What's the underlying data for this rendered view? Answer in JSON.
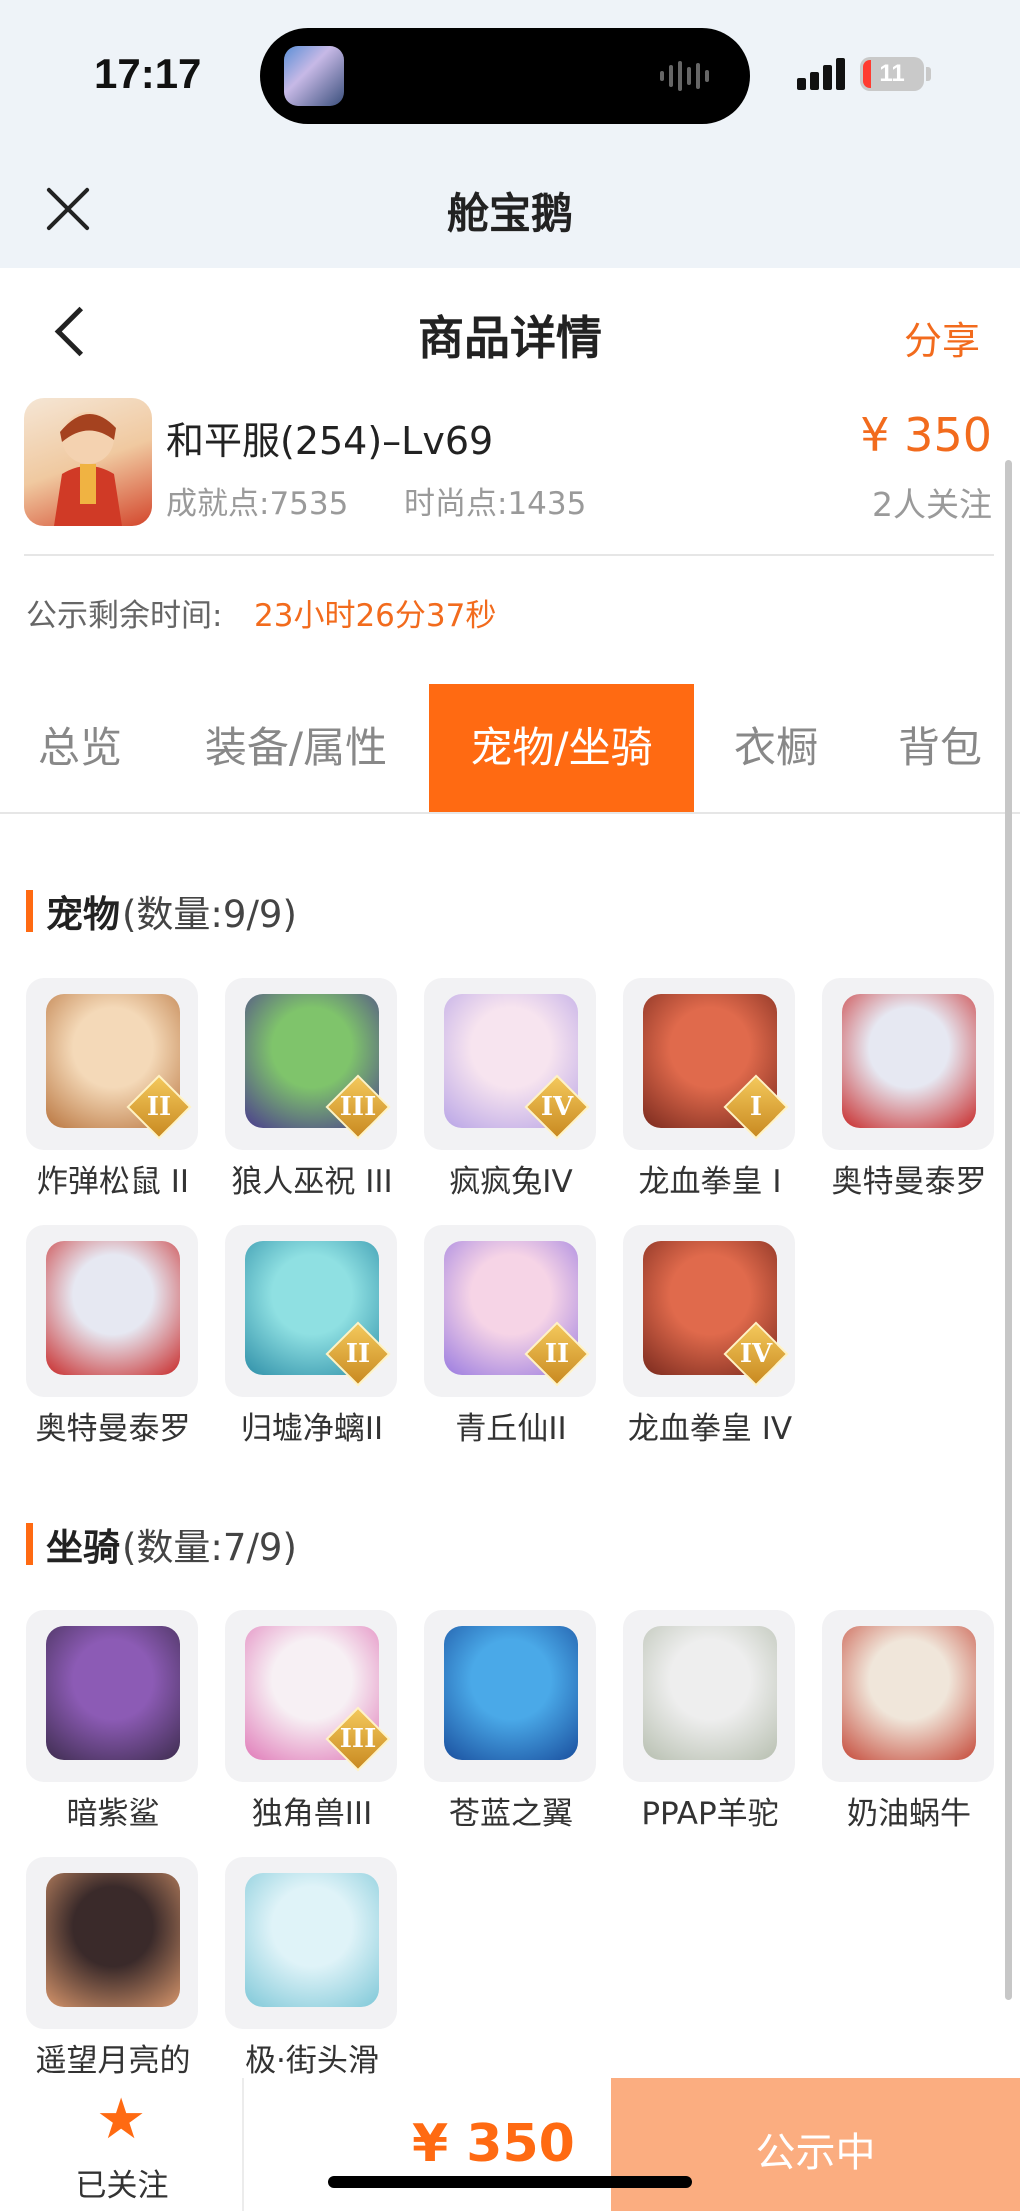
{
  "status_bar": {
    "time": "17:17",
    "battery": "11"
  },
  "app": {
    "title": "舱宝鹅"
  },
  "nav": {
    "title": "商品详情",
    "share": "分享"
  },
  "product": {
    "name": "和平服(254)–Lv69",
    "achievement": "成就点:7535",
    "fashion": "时尚点:1435",
    "price": "¥ 350",
    "followers": "2人关注"
  },
  "countdown": {
    "label": "公示剩余时间:",
    "value": "23小时26分37秒"
  },
  "tabs": [
    {
      "label": "总览"
    },
    {
      "label": "装备/属性"
    },
    {
      "label": "宠物/坐骑",
      "active": true
    },
    {
      "label": "衣橱"
    },
    {
      "label": "背包"
    }
  ],
  "pets": {
    "title": "宠物",
    "count": "(数量:9/9)",
    "items": [
      {
        "name": "炸弹松鼠 II",
        "badge": "II",
        "icon": "squirrel-pet-icon"
      },
      {
        "name": "狼人巫祝 III",
        "badge": "III",
        "icon": "werewolf-pet-icon"
      },
      {
        "name": "疯疯兔IV",
        "badge": "IV",
        "icon": "rabbit-pet-icon"
      },
      {
        "name": "龙血拳皇 I",
        "badge": "I",
        "icon": "dragon-boxer-pet-icon"
      },
      {
        "name": "奥特曼泰罗",
        "badge": "",
        "icon": "ultraman-pet-icon"
      },
      {
        "name": "奥特曼泰罗",
        "badge": "",
        "icon": "ultraman-pet-icon"
      },
      {
        "name": "归墟净螭II",
        "badge": "II",
        "icon": "water-dragon-pet-icon"
      },
      {
        "name": "青丘仙II",
        "badge": "II",
        "icon": "fox-fairy-pet-icon"
      },
      {
        "name": "龙血拳皇 IV",
        "badge": "IV",
        "icon": "dragon-boxer-pet-icon"
      }
    ]
  },
  "mounts": {
    "title": "坐骑",
    "count": "(数量:7/9)",
    "items": [
      {
        "name": "暗紫鲨",
        "badge": "",
        "icon": "shark-mount-icon"
      },
      {
        "name": "独角兽III",
        "badge": "III",
        "icon": "unicorn-mount-icon"
      },
      {
        "name": "苍蓝之翼",
        "badge": "",
        "icon": "blue-dragon-mount-icon"
      },
      {
        "name": "PPAP羊驼",
        "badge": "",
        "icon": "alpaca-mount-icon"
      },
      {
        "name": "奶油蜗牛",
        "badge": "",
        "icon": "snail-mount-icon"
      },
      {
        "name": "遥望月亮的",
        "badge": "",
        "icon": "pig-mount-icon"
      },
      {
        "name": "极·街头滑",
        "badge": "",
        "icon": "skateboard-mount-icon"
      }
    ]
  },
  "bottom_bar": {
    "follow": "已关注",
    "price": "¥ 350",
    "status": "公示中"
  },
  "colors": {
    "accent": "#ff6a12",
    "price": "#f26b1d",
    "status_button": "#fbad80"
  }
}
